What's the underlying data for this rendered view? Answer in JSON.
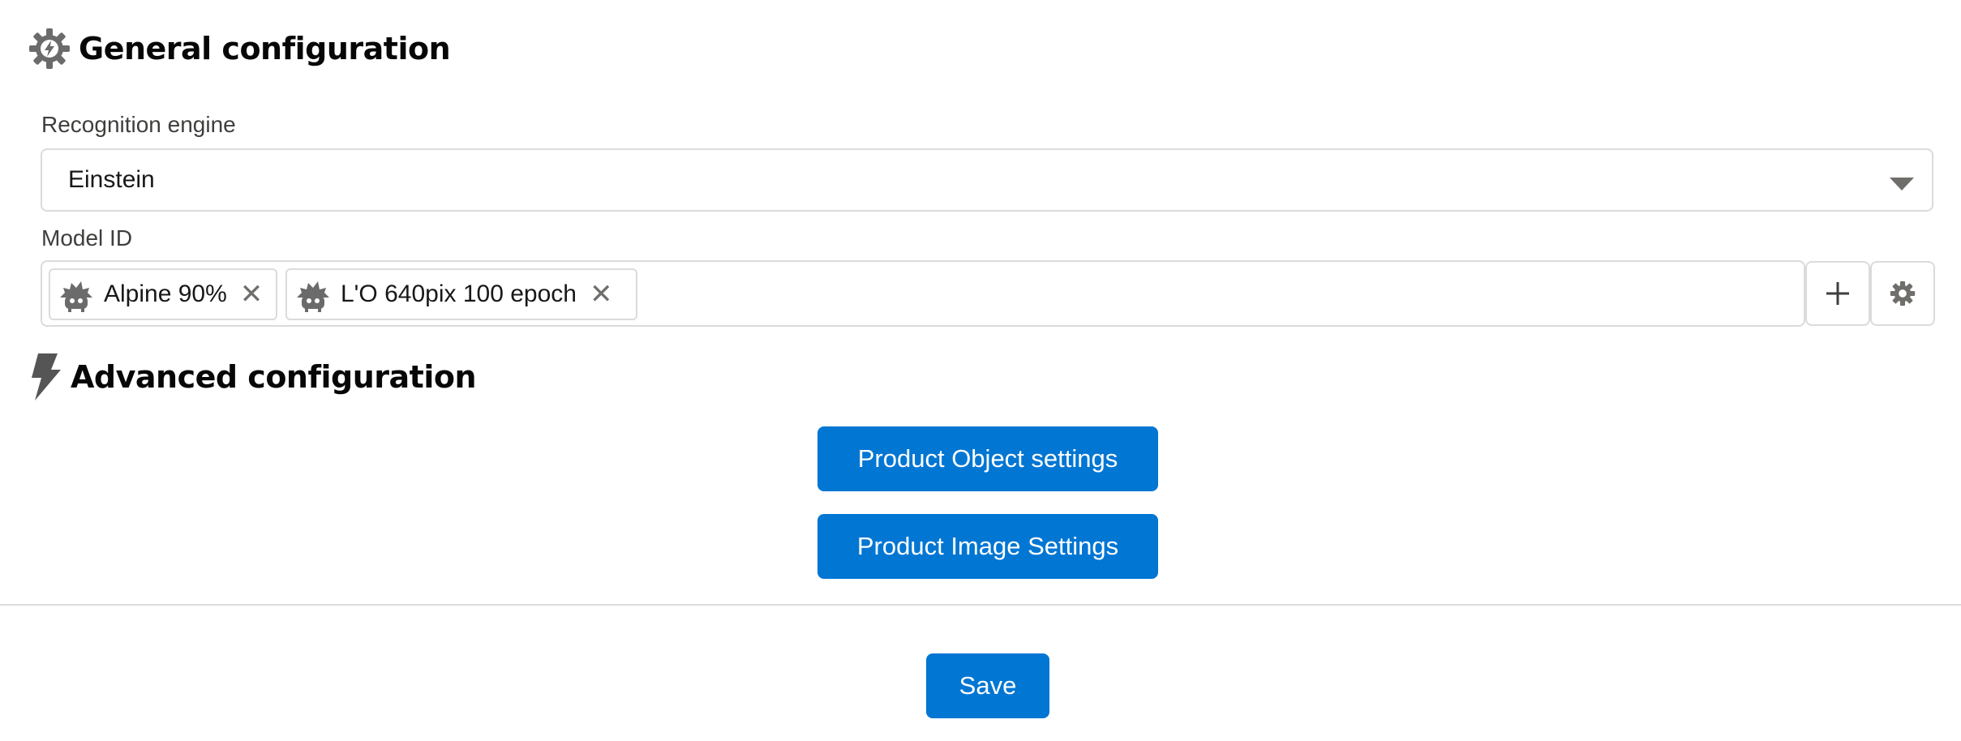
{
  "general": {
    "title": "General configuration",
    "icon": "gear-bolt-icon"
  },
  "recognition_engine": {
    "label": "Recognition engine",
    "value": "Einstein"
  },
  "model_id": {
    "label": "Model ID",
    "pills": [
      {
        "label": "Alpine 90%",
        "icon": "einstein-icon"
      },
      {
        "label": "L'O 640pix 100 epoch",
        "icon": "einstein-icon"
      }
    ],
    "add_icon": "plus-icon",
    "settings_icon": "gear-icon"
  },
  "advanced": {
    "title": "Advanced configuration",
    "icon": "lightning-bolt-icon"
  },
  "buttons": {
    "product_object": "Product Object settings",
    "product_image": "Product Image Settings",
    "save": "Save"
  },
  "colors": {
    "brand": "#0176d3",
    "border": "#dddbda",
    "icon_gray": "#706e6b"
  }
}
